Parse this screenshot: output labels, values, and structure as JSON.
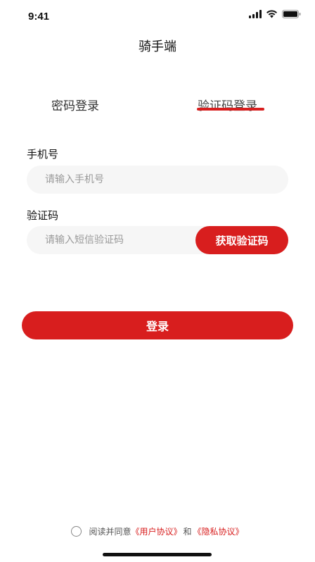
{
  "status_bar": {
    "time": "9:41"
  },
  "nav": {
    "title": "骑手端"
  },
  "tabs": [
    {
      "label": "密码登录",
      "active": false
    },
    {
      "label": "验证码登录",
      "active": true
    }
  ],
  "form": {
    "phone_label": "手机号",
    "phone_placeholder": "请输入手机号",
    "phone_value": "",
    "code_label": "验证码",
    "code_placeholder": "请输入短信验证码",
    "code_value": "",
    "get_code_button": "获取验证码",
    "login_button": "登录"
  },
  "agreement": {
    "prefix": "阅读并同意",
    "user_agreement": "《用户协议》",
    "and": "和",
    "privacy_policy": "《隐私协议》",
    "checked": false
  },
  "colors": {
    "accent": "#d81e1e",
    "input_bg": "#f6f6f6"
  }
}
